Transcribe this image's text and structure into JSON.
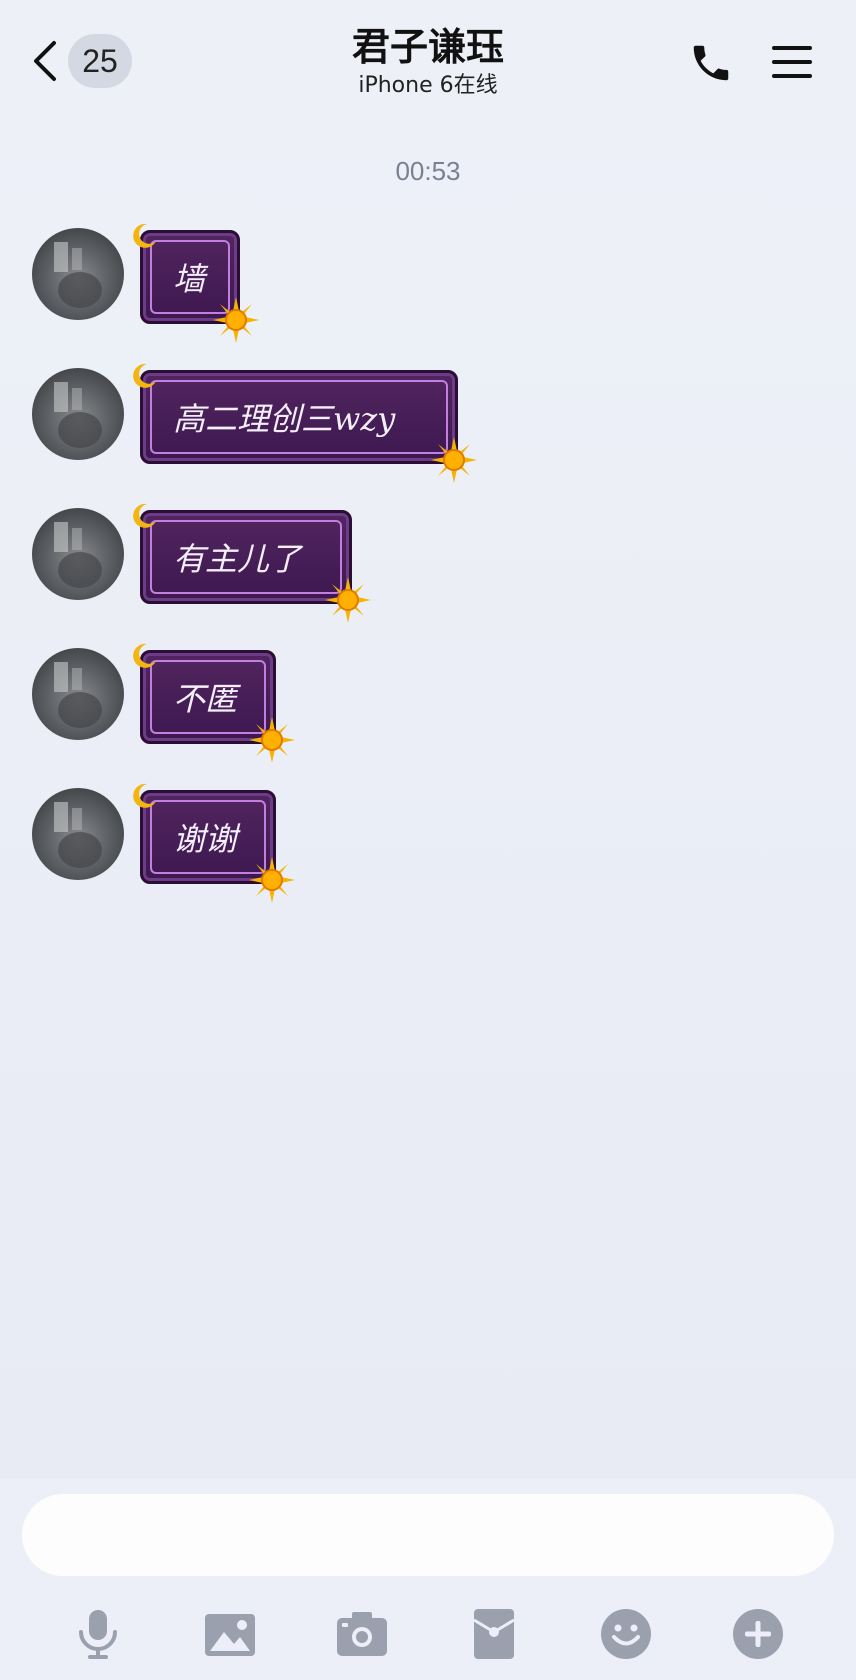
{
  "header": {
    "unread_count": "25",
    "title": "君子谦珏",
    "subtitle": "iPhone 6在线"
  },
  "chat": {
    "timestamp": "00:53",
    "messages": [
      {
        "text": "墙"
      },
      {
        "text": "高二理创三wzy"
      },
      {
        "text": "有主儿了"
      },
      {
        "text": "不匿"
      },
      {
        "text": "谢谢"
      }
    ]
  },
  "input": {
    "placeholder": ""
  },
  "toolbar": {
    "icons": [
      "microphone-icon",
      "image-icon",
      "camera-icon",
      "red-packet-icon",
      "emoji-icon",
      "plus-icon"
    ]
  },
  "colors": {
    "bubble": "#4a1f58",
    "bubble_border": "#c47de0",
    "icon_gray": "#9aa0ad",
    "background": "#e8ebf4"
  }
}
